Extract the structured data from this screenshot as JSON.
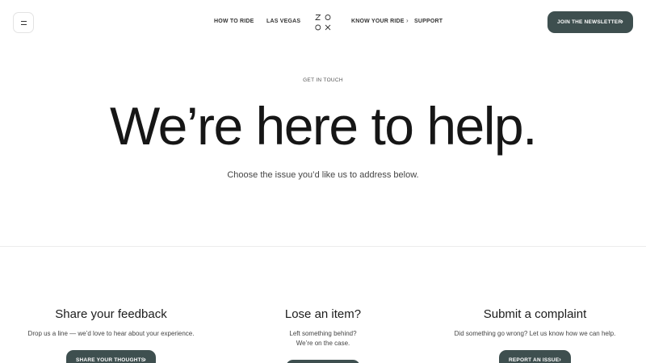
{
  "header": {
    "nav": [
      "HOW TO RIDE",
      "LAS VEGAS",
      "KNOW YOUR RIDE",
      "SUPPORT"
    ],
    "logo_text": "ZOOX",
    "newsletter_label": "JOIN THE NEWSLETTER",
    "chevron": "›"
  },
  "hero": {
    "eyebrow": "GET IN TOUCH",
    "title": "We’re here to help.",
    "subtitle": "Choose the issue you’d like us to address below."
  },
  "cards": [
    {
      "title": "Share your feedback",
      "text": "Drop us a line — we’d love to hear about your experience.",
      "button": "SHARE YOUR THOUGHTS"
    },
    {
      "title": "Lose an item?",
      "text_line1": "Left something behind?",
      "text_line2": "We’re on the case.",
      "button": ""
    },
    {
      "title": "Submit a complaint",
      "text": "Did something go wrong? Let us know how we can help.",
      "button": "REPORT AN ISSUE"
    }
  ],
  "colors": {
    "button_bg": "#3e4f4f",
    "text": "#1c1c1c"
  }
}
